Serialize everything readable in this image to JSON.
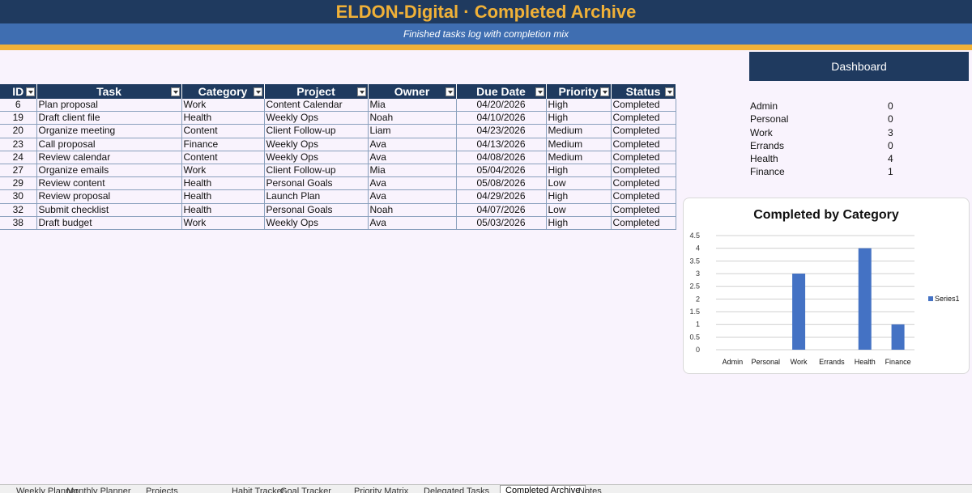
{
  "header": {
    "title": "ELDON-Digital  ·  Completed Archive",
    "subtitle": "Finished tasks log with completion mix"
  },
  "dashboard_button": "Dashboard",
  "table": {
    "columns": [
      "ID",
      "Task",
      "Category",
      "Project",
      "Owner",
      "Due Date",
      "Priority",
      "Status"
    ],
    "rows": [
      [
        "6",
        "Plan proposal",
        "Work",
        "Content Calendar",
        "Mia",
        "04/20/2026",
        "High",
        "Completed"
      ],
      [
        "19",
        "Draft client file",
        "Health",
        "Weekly Ops",
        "Noah",
        "04/10/2026",
        "High",
        "Completed"
      ],
      [
        "20",
        "Organize meeting",
        "Content",
        "Client Follow-up",
        "Liam",
        "04/23/2026",
        "Medium",
        "Completed"
      ],
      [
        "23",
        "Call proposal",
        "Finance",
        "Weekly Ops",
        "Ava",
        "04/13/2026",
        "Medium",
        "Completed"
      ],
      [
        "24",
        "Review calendar",
        "Content",
        "Weekly Ops",
        "Ava",
        "04/08/2026",
        "Medium",
        "Completed"
      ],
      [
        "27",
        "Organize emails",
        "Work",
        "Client Follow-up",
        "Mia",
        "05/04/2026",
        "High",
        "Completed"
      ],
      [
        "29",
        "Review content",
        "Health",
        "Personal Goals",
        "Ava",
        "05/08/2026",
        "Low",
        "Completed"
      ],
      [
        "30",
        "Review proposal",
        "Health",
        "Launch Plan",
        "Ava",
        "04/29/2026",
        "High",
        "Completed"
      ],
      [
        "32",
        "Submit checklist",
        "Health",
        "Personal Goals",
        "Noah",
        "04/07/2026",
        "Low",
        "Completed"
      ],
      [
        "38",
        "Draft budget",
        "Work",
        "Weekly Ops",
        "Ava",
        "05/03/2026",
        "High",
        "Completed"
      ]
    ]
  },
  "summary": [
    {
      "label": "Admin",
      "value": "0"
    },
    {
      "label": "Personal",
      "value": "0"
    },
    {
      "label": "Work",
      "value": "3"
    },
    {
      "label": "Errands",
      "value": "0"
    },
    {
      "label": "Health",
      "value": "4"
    },
    {
      "label": "Finance",
      "value": "1"
    }
  ],
  "chart_data": {
    "type": "bar",
    "title": "Completed by Category",
    "categories": [
      "Admin",
      "Personal",
      "Work",
      "Errands",
      "Health",
      "Finance"
    ],
    "series": [
      {
        "name": "Series1",
        "values": [
          0,
          0,
          3,
          0,
          4,
          1
        ]
      }
    ],
    "ylim": [
      0,
      4.5
    ],
    "yticks": [
      "0",
      "0.5",
      "1",
      "1.5",
      "2",
      "2.5",
      "3",
      "3.5",
      "4",
      "4.5"
    ],
    "grid": true,
    "legend": "right",
    "bar_color": "#4472c4"
  },
  "sheet_tabs": [
    "Weekly Planner",
    "Monthly Planner",
    "Projects",
    "Habit Tracker",
    "Goal Tracker",
    "Priority Matrix",
    "Delegated Tasks",
    "Completed Archive",
    "Notes"
  ],
  "active_tab": "Completed Archive",
  "colors": {
    "navy": "#1f3a5f",
    "gold": "#f0b138",
    "blue": "#3f6eb1"
  }
}
